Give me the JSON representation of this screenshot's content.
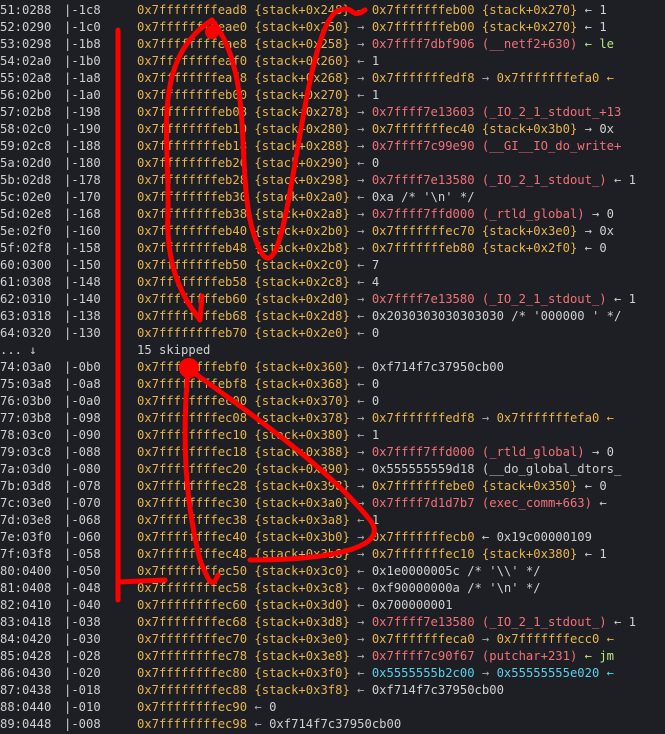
{
  "rows": [
    {
      "idx": "51:0288",
      "ofs": "-1c8",
      "addr": "0x7ffffffffead8",
      "ref": "{stack+0x248}",
      "arrow": "→",
      "s1": "0x7fffffffeb00",
      "s1c": "y",
      "s2": "{stack+0x270}",
      "s2c": "y",
      "tail": "← 1",
      "tailc": "gray"
    },
    {
      "idx": "52:0290",
      "ofs": "-1c0",
      "addr": "0x7ffffffffeae0",
      "ref": "{stack+0x250}",
      "arrow": "→",
      "s1": "0x7fffffffeb00",
      "s1c": "y",
      "s2": "{stack+0x270}",
      "s2c": "y",
      "tail": "← 1",
      "tailc": "gray"
    },
    {
      "idx": "53:0298",
      "ofs": "-1b8",
      "addr": "0x7ffffffffeae8",
      "ref": "{stack+0x258}",
      "arrow": "→",
      "s1": "0x7ffff7dbf906",
      "s1c": "r",
      "s2": "(__netf2+630)",
      "s2c": "r",
      "tail": "← le",
      "tailc": "g"
    },
    {
      "idx": "54:02a0",
      "ofs": "-1b0",
      "addr": "0x7ffffffffeaf0",
      "ref": "{stack+0x260}",
      "arrow": "←",
      "s1": "1",
      "s1c": "gray",
      "s2": "",
      "s2c": "",
      "tail": "",
      "tailc": ""
    },
    {
      "idx": "55:02a8",
      "ofs": "-1a8",
      "addr": "0x7ffffffffeaf8",
      "ref": "{stack+0x268}",
      "arrow": "→",
      "s1": "0x7fffffffedf8",
      "s1c": "y",
      "s2": "→",
      "s2c": "sep",
      "tail": "0x7fffffffefa0 ←",
      "tailc": "y"
    },
    {
      "idx": "56:02b0",
      "ofs": "-1a0",
      "addr": "0x7ffffffffeb00",
      "ref": "{stack+0x270}",
      "arrow": "←",
      "s1": "1",
      "s1c": "gray",
      "s2": "",
      "s2c": "",
      "tail": "",
      "tailc": ""
    },
    {
      "idx": "57:02b8",
      "ofs": "-198",
      "addr": "0x7ffffffffeb08",
      "ref": "{stack+0x278}",
      "arrow": "→",
      "s1": "0x7ffff7e13603",
      "s1c": "r",
      "s2": "(_IO_2_1_stdout_+13",
      "s2c": "r",
      "tail": "",
      "tailc": ""
    },
    {
      "idx": "58:02c0",
      "ofs": "-190",
      "addr": "0x7ffffffffeb10",
      "ref": "{stack+0x280}",
      "arrow": "→",
      "s1": "0x7fffffffec40",
      "s1c": "y",
      "s2": "{stack+0x3b0}",
      "s2c": "y",
      "tail": "→ 0x",
      "tailc": "gray"
    },
    {
      "idx": "59:02c8",
      "ofs": "-188",
      "addr": "0x7ffffffffeb18",
      "ref": "{stack+0x288}",
      "arrow": "→",
      "s1": "0x7ffff7c99e90",
      "s1c": "r",
      "s2": "(__GI__IO_do_write+",
      "s2c": "r",
      "tail": "",
      "tailc": ""
    },
    {
      "idx": "5a:02d0",
      "ofs": "-180",
      "addr": "0x7ffffffffeb20",
      "ref": "{stack+0x290}",
      "arrow": "←",
      "s1": "0",
      "s1c": "gray",
      "s2": "",
      "s2c": "",
      "tail": "",
      "tailc": ""
    },
    {
      "idx": "5b:02d8",
      "ofs": "-178",
      "addr": "0x7ffffffffeb28",
      "ref": "{stack+0x298}",
      "arrow": "→",
      "s1": "0x7ffff7e13580",
      "s1c": "r",
      "s2": "(_IO_2_1_stdout_)",
      "s2c": "r",
      "tail": "← 1",
      "tailc": "gray"
    },
    {
      "idx": "5c:02e0",
      "ofs": "-170",
      "addr": "0x7ffffffffeb30",
      "ref": "{stack+0x2a0}",
      "arrow": "←",
      "s1": "0xa /* '\\n' */",
      "s1c": "gray",
      "s2": "",
      "s2c": "",
      "tail": "",
      "tailc": ""
    },
    {
      "idx": "5d:02e8",
      "ofs": "-168",
      "addr": "0x7ffffffffeb38",
      "ref": "{stack+0x2a8}",
      "arrow": "→",
      "s1": "0x7ffff7ffd000",
      "s1c": "r",
      "s2": "(_rtld_global)",
      "s2c": "r",
      "tail": "→ 0",
      "tailc": "gray"
    },
    {
      "idx": "5e:02f0",
      "ofs": "-160",
      "addr": "0x7ffffffffeb40",
      "ref": "{stack+0x2b0}",
      "arrow": "→",
      "s1": "0x7fffffffec70",
      "s1c": "y",
      "s2": "{stack+0x3e0}",
      "s2c": "y",
      "tail": "→ 0x",
      "tailc": "gray"
    },
    {
      "idx": "5f:02f8",
      "ofs": "-158",
      "addr": "0x7ffffffffeb48",
      "ref": "{stack+0x2b8}",
      "arrow": "→",
      "s1": "0x7fffffffeb80",
      "s1c": "y",
      "s2": "{stack+0x2f0}",
      "s2c": "y",
      "tail": "← 0",
      "tailc": "gray"
    },
    {
      "idx": "60:0300",
      "ofs": "-150",
      "addr": "0x7ffffffffeb50",
      "ref": "{stack+0x2c0}",
      "arrow": "←",
      "s1": "7",
      "s1c": "gray",
      "s2": "",
      "s2c": "",
      "tail": "",
      "tailc": ""
    },
    {
      "idx": "61:0308",
      "ofs": "-148",
      "addr": "0x7ffffffffeb58",
      "ref": "{stack+0x2c8}",
      "arrow": "←",
      "s1": "4",
      "s1c": "gray",
      "s2": "",
      "s2c": "",
      "tail": "",
      "tailc": ""
    },
    {
      "idx": "62:0310",
      "ofs": "-140",
      "addr": "0x7ffffffffeb60",
      "ref": "{stack+0x2d0}",
      "arrow": "→",
      "s1": "0x7ffff7e13580",
      "s1c": "r",
      "s2": "(_IO_2_1_stdout_)",
      "s2c": "r",
      "tail": "← 1",
      "tailc": "gray"
    },
    {
      "idx": "63:0318",
      "ofs": "-138",
      "addr": "0x7ffffffffeb68",
      "ref": "{stack+0x2d8}",
      "arrow": "←",
      "s1": "0x2030303030303030 /* '000000 ' */",
      "s1c": "gray",
      "s2": "",
      "s2c": "",
      "tail": "",
      "tailc": ""
    },
    {
      "idx": "64:0320",
      "ofs": "-130",
      "addr": "0x7ffffffffeb70",
      "ref": "{stack+0x2e0}",
      "arrow": "←",
      "s1": "0",
      "s1c": "gray",
      "s2": "",
      "s2c": "",
      "tail": "",
      "tailc": ""
    },
    {
      "skip": true,
      "idx": "... ↓",
      "text": "15 skipped"
    },
    {
      "idx": "74:03a0",
      "ofs": "-0b0",
      "addr": "0x7ffffffffebf0",
      "ref": "{stack+0x360}",
      "arrow": "←",
      "s1": "0xf714f7c37950cb00",
      "s1c": "gray",
      "s2": "",
      "s2c": "",
      "tail": "",
      "tailc": ""
    },
    {
      "idx": "75:03a8",
      "ofs": "-0a8",
      "addr": "0x7ffffffffebf8",
      "ref": "{stack+0x368}",
      "arrow": "←",
      "s1": "0",
      "s1c": "gray",
      "s2": "",
      "s2c": "",
      "tail": "",
      "tailc": ""
    },
    {
      "idx": "76:03b0",
      "ofs": "-0a0",
      "addr": "0x7ffffffffec00",
      "ref": "{stack+0x370}",
      "arrow": "←",
      "s1": "0",
      "s1c": "gray",
      "s2": "",
      "s2c": "",
      "tail": "",
      "tailc": ""
    },
    {
      "idx": "77:03b8",
      "ofs": "-098",
      "addr": "0x7ffffffffec08",
      "ref": "{stack+0x378}",
      "arrow": "→",
      "s1": "0x7fffffffedf8",
      "s1c": "y",
      "s2": "→",
      "s2c": "sep",
      "tail": "0x7fffffffefa0 ←",
      "tailc": "y"
    },
    {
      "idx": "78:03c0",
      "ofs": "-090",
      "addr": "0x7ffffffffec10",
      "ref": "{stack+0x380}",
      "arrow": "←",
      "s1": "1",
      "s1c": "gray",
      "s2": "",
      "s2c": "",
      "tail": "",
      "tailc": ""
    },
    {
      "idx": "79:03c8",
      "ofs": "-088",
      "addr": "0x7ffffffffec18",
      "ref": "{stack+0x388}",
      "arrow": "→",
      "s1": "0x7ffff7ffd000",
      "s1c": "r",
      "s2": "(_rtld_global)",
      "s2c": "r",
      "tail": "→ 0",
      "tailc": "gray"
    },
    {
      "idx": "7a:03d0",
      "ofs": "-080",
      "addr": "0x7ffffffffec20",
      "ref": "{stack+0x390}",
      "arrow": "→",
      "s1": "0x555555559d18",
      "s1c": "gray",
      "s2": "(__do_global_dtors_",
      "s2c": "gray",
      "tail": "",
      "tailc": ""
    },
    {
      "idx": "7b:03d8",
      "ofs": "-078",
      "addr": "0x7ffffffffec28",
      "ref": "{stack+0x398}",
      "arrow": "→",
      "s1": "0x7fffffffebe0",
      "s1c": "y",
      "s2": "{stack+0x350}",
      "s2c": "y",
      "tail": "← 0",
      "tailc": "gray"
    },
    {
      "idx": "7c:03e0",
      "ofs": "-070",
      "addr": "0x7ffffffffec30",
      "ref": "{stack+0x3a0}",
      "arrow": "→",
      "s1": "0x7ffff7d1d7b7",
      "s1c": "r",
      "s2": "(exec_comm+663)",
      "s2c": "r",
      "tail": "←",
      "tailc": "gray"
    },
    {
      "idx": "7d:03e8",
      "ofs": "-068",
      "addr": "0x7ffffffffec38",
      "ref": "{stack+0x3a8}",
      "arrow": "←",
      "s1": "1",
      "s1c": "gray",
      "s2": "",
      "s2c": "",
      "tail": "",
      "tailc": ""
    },
    {
      "idx": "7e:03f0",
      "ofs": "-060",
      "addr": "0x7ffffffffec40",
      "ref": "{stack+0x3b0}",
      "arrow": "→",
      "s1": "0x7fffffffecb0",
      "s1c": "y",
      "s2": "← 0x19c00000109",
      "s2c": "gray",
      "tail": "",
      "tailc": ""
    },
    {
      "idx": "7f:03f8",
      "ofs": "-058",
      "addr": "0x7ffffffffec48",
      "ref": "{stack+0x3b8}",
      "arrow": "→",
      "s1": "0x7fffffffec10",
      "s1c": "y",
      "s2": "{stack+0x380}",
      "s2c": "y",
      "tail": "← 1",
      "tailc": "gray"
    },
    {
      "idx": "80:0400",
      "ofs": "-050",
      "addr": "0x7ffffffffec50",
      "ref": "{stack+0x3c0}",
      "arrow": "←",
      "s1": "0x1e0000005c /* '\\\\' */",
      "s1c": "gray",
      "s2": "",
      "s2c": "",
      "tail": "",
      "tailc": ""
    },
    {
      "idx": "81:0408",
      "ofs": "-048",
      "addr": "0x7ffffffffec58",
      "ref": "{stack+0x3c8}",
      "arrow": "←",
      "s1": "0xf90000000a /* '\\n' */",
      "s1c": "gray",
      "s2": "",
      "s2c": "",
      "tail": "",
      "tailc": ""
    },
    {
      "idx": "82:0410",
      "ofs": "-040",
      "addr": "0x7ffffffffec60",
      "ref": "{stack+0x3d0}",
      "arrow": "←",
      "s1": "0x700000001",
      "s1c": "gray",
      "s2": "",
      "s2c": "",
      "tail": "",
      "tailc": ""
    },
    {
      "idx": "83:0418",
      "ofs": "-038",
      "addr": "0x7ffffffffec68",
      "ref": "{stack+0x3d8}",
      "arrow": "→",
      "s1": "0x7ffff7e13580",
      "s1c": "r",
      "s2": "(_IO_2_1_stdout_)",
      "s2c": "r",
      "tail": "← 1",
      "tailc": "gray"
    },
    {
      "idx": "84:0420",
      "ofs": "-030",
      "addr": "0x7ffffffffec70",
      "ref": "{stack+0x3e0}",
      "arrow": "→",
      "s1": "0x7fffffffeca0",
      "s1c": "y",
      "s2": "→",
      "s2c": "sep",
      "tail": "0x7fffffffecc0 ←",
      "tailc": "y"
    },
    {
      "idx": "85:0428",
      "ofs": "-028",
      "addr": "0x7ffffffffec78",
      "ref": "{stack+0x3e8}",
      "arrow": "→",
      "s1": "0x7ffff7c90f67",
      "s1c": "r",
      "s2": "(putchar+231)",
      "s2c": "r",
      "tail": "← jm",
      "tailc": "g"
    },
    {
      "idx": "86:0430",
      "ofs": "-020",
      "addr": "0x7ffffffffec80",
      "ref": "{stack+0x3f0}",
      "arrow": "←",
      "s1": "0x5555555b2c00",
      "s1c": "b",
      "s2": "→",
      "s2c": "sep",
      "tail": "0x55555555e020 ←",
      "tailc": "b"
    },
    {
      "idx": "87:0438",
      "ofs": "-018",
      "addr": "0x7ffffffffec88",
      "ref": "{stack+0x3f8}",
      "arrow": "←",
      "s1": "0xf714f7c37950cb00",
      "s1c": "gray",
      "s2": "",
      "s2c": "",
      "tail": "",
      "tailc": ""
    },
    {
      "idx": "88:0440",
      "ofs": "-010",
      "addr": "0x7ffffffffec90",
      "ref": "",
      "arrow": "←",
      "s1": "0",
      "s1c": "gray",
      "s2": "",
      "s2c": "",
      "tail": "",
      "tailc": ""
    },
    {
      "idx": "89:0448",
      "ofs": "-008",
      "addr": "0x7ffffffffec98",
      "ref": "",
      "arrow": "←",
      "s1": "0xf714f7c37950cb00",
      "s1c": "gray",
      "s2": "",
      "s2c": "",
      "tail": "",
      "tailc": ""
    }
  ],
  "colors": {
    "background": "#1e1f24",
    "address": "#e6b450",
    "code": "#f07178",
    "heap": "#5ccfe6",
    "annotation": "#ff0000"
  }
}
